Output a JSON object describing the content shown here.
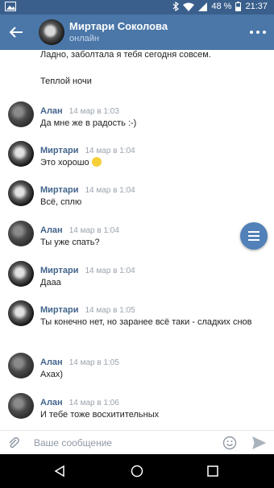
{
  "status_bar": {
    "battery": "48 %",
    "time": "21:37"
  },
  "header": {
    "contact_name": "Миртари Соколова",
    "status": "онлайн"
  },
  "chat": {
    "continued_lines": [
      "Ладно, заболтала я тебя сегодня совсем.",
      "Теплой ночи"
    ],
    "messages": [
      {
        "sender": "Алан",
        "time": "14 мар в 1:03",
        "text": "Да мне же в радость :-)"
      },
      {
        "sender": "Миртари",
        "time": "14 мар в 1:04",
        "text": "Это хорошо"
      },
      {
        "sender": "Миртари",
        "time": "14 мар в 1:04",
        "text": "Всё, сплю"
      },
      {
        "sender": "Алан",
        "time": "14 мар в 1:04",
        "text": "Ты уже спать?"
      },
      {
        "sender": "Миртари",
        "time": "14 мар в 1:04",
        "text": "Дааа"
      },
      {
        "sender": "Миртари",
        "time": "14 мар в 1:05",
        "text": "Ты конечно нет, но заранее всё таки - сладких снов"
      },
      {
        "sender": "Алан",
        "time": "14 мар в 1:05",
        "text": "Ахах)"
      },
      {
        "sender": "Алан",
        "time": "14 мар в 1:06",
        "text": "И тебе тоже восхитительных"
      }
    ]
  },
  "composer": {
    "placeholder": "Ваше сообщение"
  },
  "colors": {
    "header": "#4a76a8",
    "status_bar": "#3a5f8c",
    "name_link": "#42648b",
    "fab": "#5181b8"
  }
}
